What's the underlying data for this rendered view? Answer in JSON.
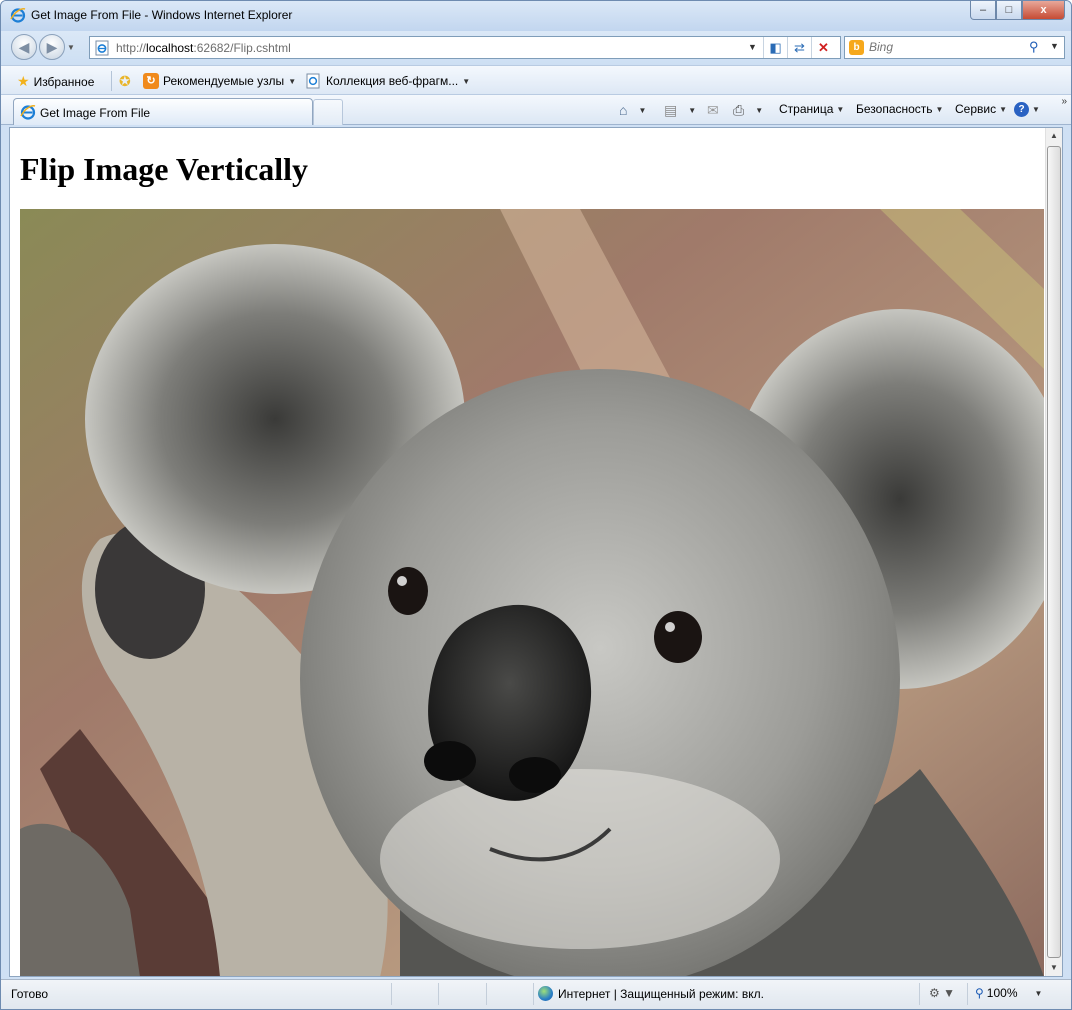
{
  "window": {
    "title": "Get Image From File - Windows Internet Explorer",
    "buttons": {
      "minimize": "–",
      "maximize": "□",
      "close": "x"
    }
  },
  "address": {
    "url_prefix": "http://",
    "url_host": "localhost",
    "url_rest": ":62682/Flip.cshtml"
  },
  "search": {
    "placeholder": "Bing"
  },
  "favorites": {
    "favorites_label": "Избранное",
    "items": [
      {
        "label": "Рекомендуемые узлы",
        "icon": "suggested-sites-icon"
      },
      {
        "label": "Коллекция веб-фрагм...",
        "icon": "web-slice-icon"
      }
    ]
  },
  "tab": {
    "label": "Get Image From File"
  },
  "commands": {
    "page": "Страница",
    "safety": "Безопасность",
    "tools": "Сервис"
  },
  "page": {
    "heading": "Flip Image Vertically",
    "image_alt": "koala photo"
  },
  "status": {
    "ready": "Готово",
    "zone": "Интернет | Защищенный режим: вкл.",
    "zoom": "100%"
  }
}
